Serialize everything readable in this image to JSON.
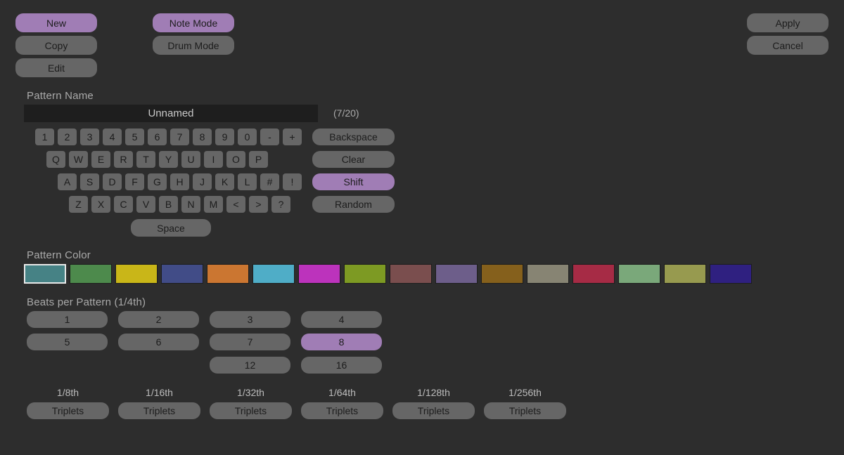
{
  "theme": {
    "background": "#2d2d2d",
    "button": "#666666",
    "button_active": "#a07db5",
    "label": "#aaaaaa",
    "field_bg": "#1e1e1e"
  },
  "toolbar": {
    "left_buttons": [
      {
        "label": "New",
        "active": true
      },
      {
        "label": "Copy",
        "active": false
      },
      {
        "label": "Edit",
        "active": false
      }
    ],
    "mode_buttons": [
      {
        "label": "Note Mode",
        "active": true
      },
      {
        "label": "Drum Mode",
        "active": false
      }
    ],
    "right_buttons": [
      {
        "label": "Apply",
        "active": false
      },
      {
        "label": "Cancel",
        "active": false
      }
    ]
  },
  "pattern_name": {
    "label": "Pattern Name",
    "value": "Unnamed",
    "placeholder": "Unnamed",
    "char_count": "(7/20)"
  },
  "keyboard": {
    "row1": [
      "1",
      "2",
      "3",
      "4",
      "5",
      "6",
      "7",
      "8",
      "9",
      "0",
      "-",
      "+"
    ],
    "row2": [
      "Q",
      "W",
      "E",
      "R",
      "T",
      "Y",
      "U",
      "I",
      "O",
      "P"
    ],
    "row3": [
      "A",
      "S",
      "D",
      "F",
      "G",
      "H",
      "J",
      "K",
      "L",
      "#",
      "!"
    ],
    "row4": [
      "Z",
      "X",
      "C",
      "V",
      "B",
      "N",
      "M",
      "<",
      ">",
      "?"
    ],
    "space": "Space",
    "actions": [
      {
        "label": "Backspace",
        "active": false
      },
      {
        "label": "Clear",
        "active": false
      },
      {
        "label": "Shift",
        "active": true
      },
      {
        "label": "Random",
        "active": false
      }
    ]
  },
  "pattern_color": {
    "label": "Pattern Color",
    "selected_index": 0,
    "swatches": [
      "#468285",
      "#4d8a4c",
      "#c9b618",
      "#414c87",
      "#cb7631",
      "#4fadc7",
      "#bc33bc",
      "#7d9a23",
      "#7a4e4e",
      "#6d5e8a",
      "#85601c",
      "#878473",
      "#a62b45",
      "#7aa87a",
      "#979a4f",
      "#2f2080"
    ]
  },
  "beats": {
    "label": "Beats per Pattern (1/4th)",
    "options": [
      {
        "label": "1",
        "active": false
      },
      {
        "label": "2",
        "active": false
      },
      {
        "label": "3",
        "active": false
      },
      {
        "label": "4",
        "active": false
      },
      {
        "label": "5",
        "active": false
      },
      {
        "label": "6",
        "active": false
      },
      {
        "label": "7",
        "active": false
      },
      {
        "label": "8",
        "active": true
      },
      {
        "label": "12",
        "active": false
      },
      {
        "label": "16",
        "active": false
      }
    ]
  },
  "triplets": {
    "button_label": "Triplets",
    "divisions": [
      "1/8th",
      "1/16th",
      "1/32th",
      "1/64th",
      "1/128th",
      "1/256th"
    ]
  }
}
